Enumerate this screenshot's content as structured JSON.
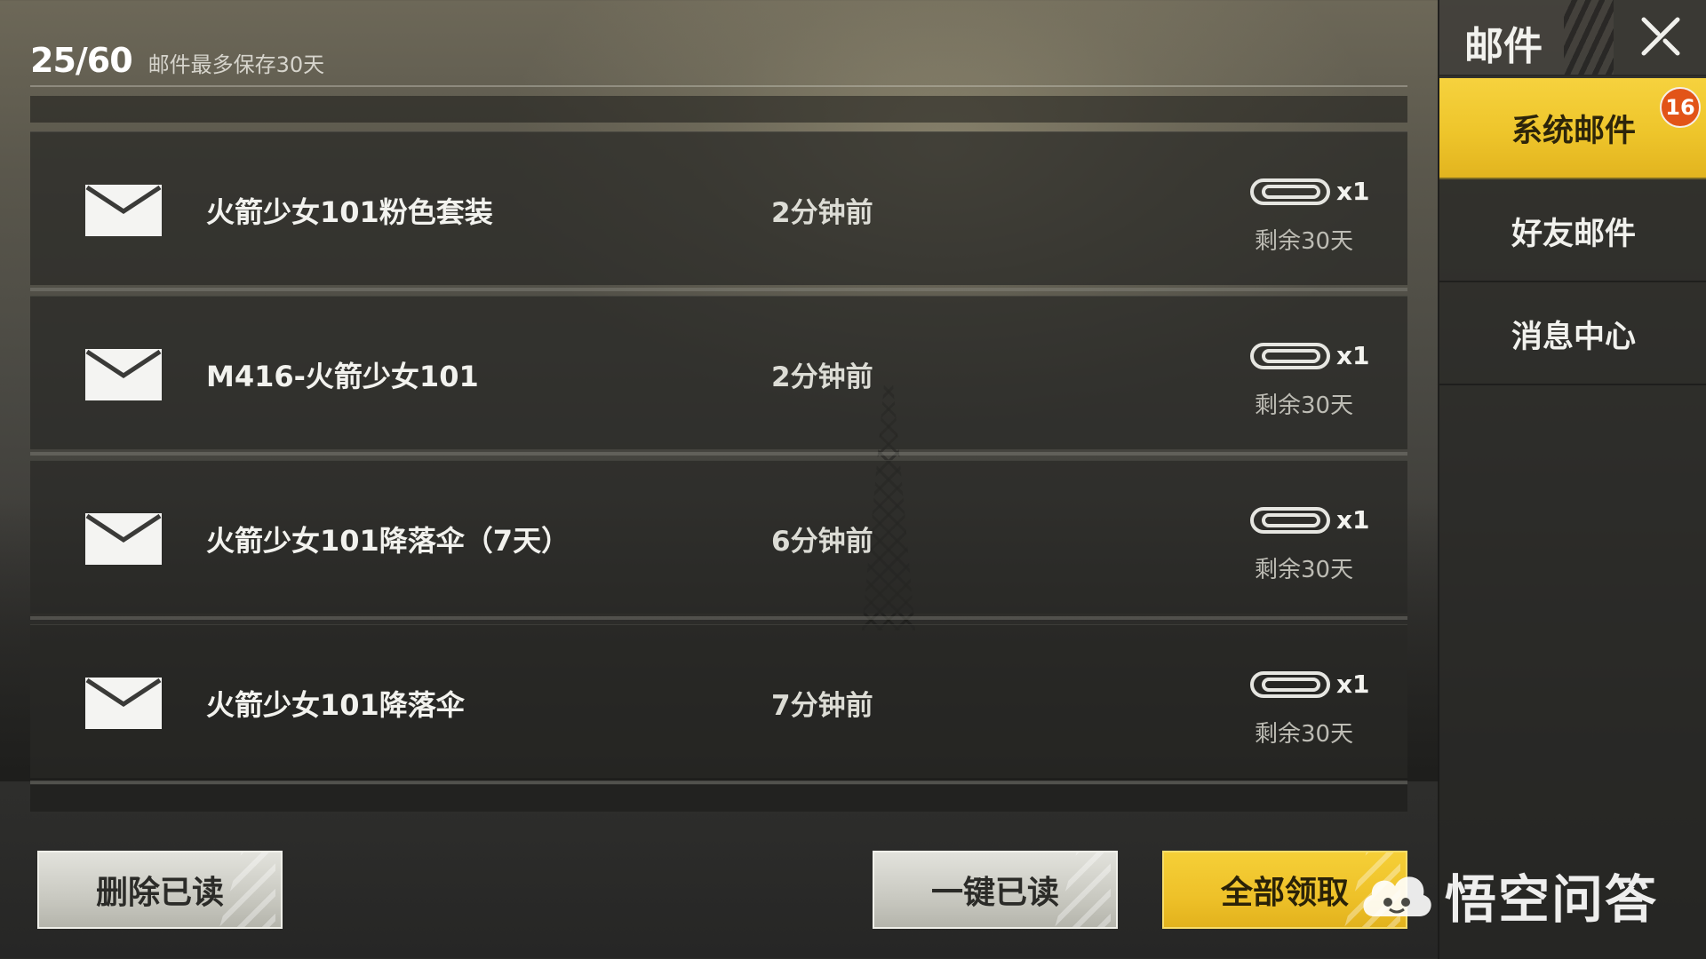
{
  "header": {
    "count": "25/60",
    "retention_note": "邮件最多保存30天"
  },
  "mails": [
    {
      "title": "火箭少女101粉色套装",
      "time": "2分钟前",
      "attach_count": "x1",
      "remaining": "剩余30天"
    },
    {
      "title": "M416-火箭少女101",
      "time": "2分钟前",
      "attach_count": "x1",
      "remaining": "剩余30天"
    },
    {
      "title": "火箭少女101降落伞（7天）",
      "time": "6分钟前",
      "attach_count": "x1",
      "remaining": "剩余30天"
    },
    {
      "title": "火箭少女101降落伞",
      "time": "7分钟前",
      "attach_count": "x1",
      "remaining": "剩余30天"
    }
  ],
  "buttons": {
    "delete_read": "删除已读",
    "mark_all_read": "一键已读",
    "claim_all": "全部领取"
  },
  "side_panel": {
    "title": "邮件",
    "tabs": [
      {
        "label": "系统邮件",
        "active": true,
        "badge": "16"
      },
      {
        "label": "好友邮件",
        "active": false
      },
      {
        "label": "消息中心",
        "active": false
      }
    ]
  },
  "watermark": {
    "text": "悟空问答",
    "icon": "cloud-face-icon"
  },
  "colors": {
    "accent_yellow": "#eec52b",
    "badge_orange": "#e25418",
    "button_gray": "#c9c9c1"
  },
  "icons": {
    "mail": "envelope-icon",
    "attachment": "paperclip-icon",
    "close": "close-icon"
  }
}
